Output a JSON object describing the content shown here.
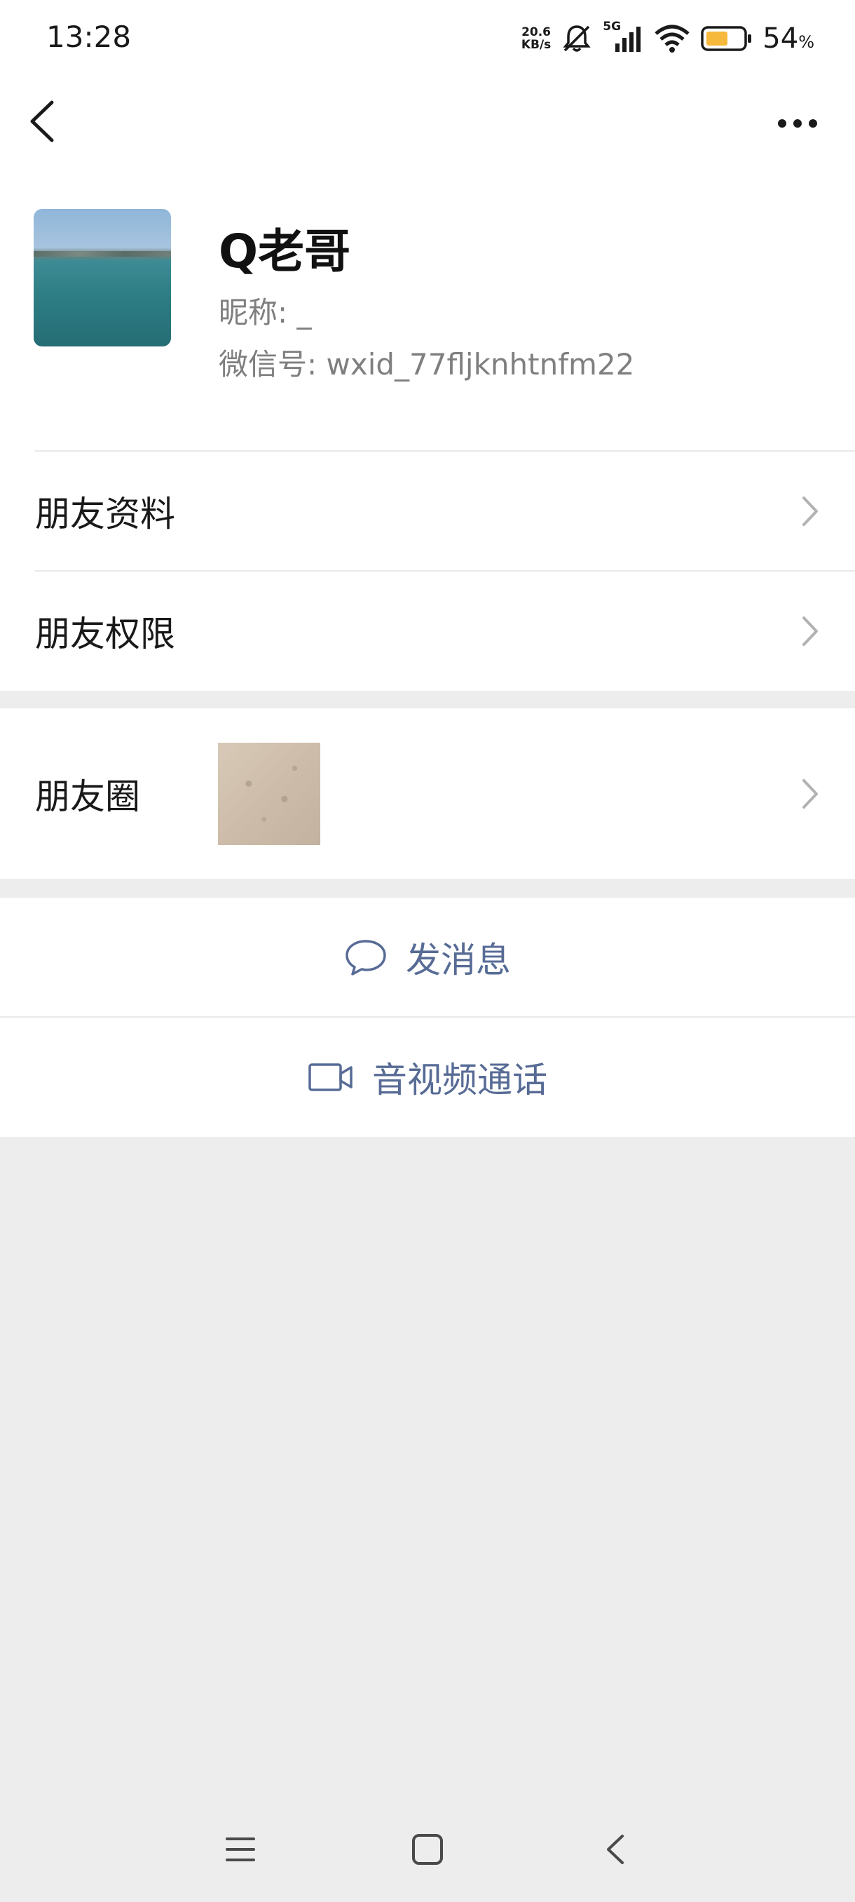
{
  "status_bar": {
    "time": "13:28",
    "net_speed_value": "20.6",
    "net_speed_unit": "KB/s",
    "network": "5G",
    "battery_percent": "54",
    "battery_percent_sign": "%",
    "battery_color": "#f6b93b"
  },
  "profile": {
    "name": "Q老哥",
    "nickname_line": "昵称: _",
    "wxid_line": "微信号: wxid_77fljknhtnfm22"
  },
  "menu": {
    "friend_info": "朋友资料",
    "friend_permissions": "朋友权限",
    "moments": "朋友圈"
  },
  "actions": {
    "send_message": "发消息",
    "av_call": "音视频通话"
  },
  "colors": {
    "accent": "#576b95",
    "background": "#ededed",
    "surface": "#ffffff"
  },
  "icons": {
    "back": "back-icon",
    "more": "more-icon",
    "chevron": "chevron-right-icon",
    "message": "message-bubble-icon",
    "video": "video-camera-icon",
    "nav_menu": "menu-icon",
    "nav_home": "home-icon",
    "nav_back": "back-triangle-icon"
  }
}
